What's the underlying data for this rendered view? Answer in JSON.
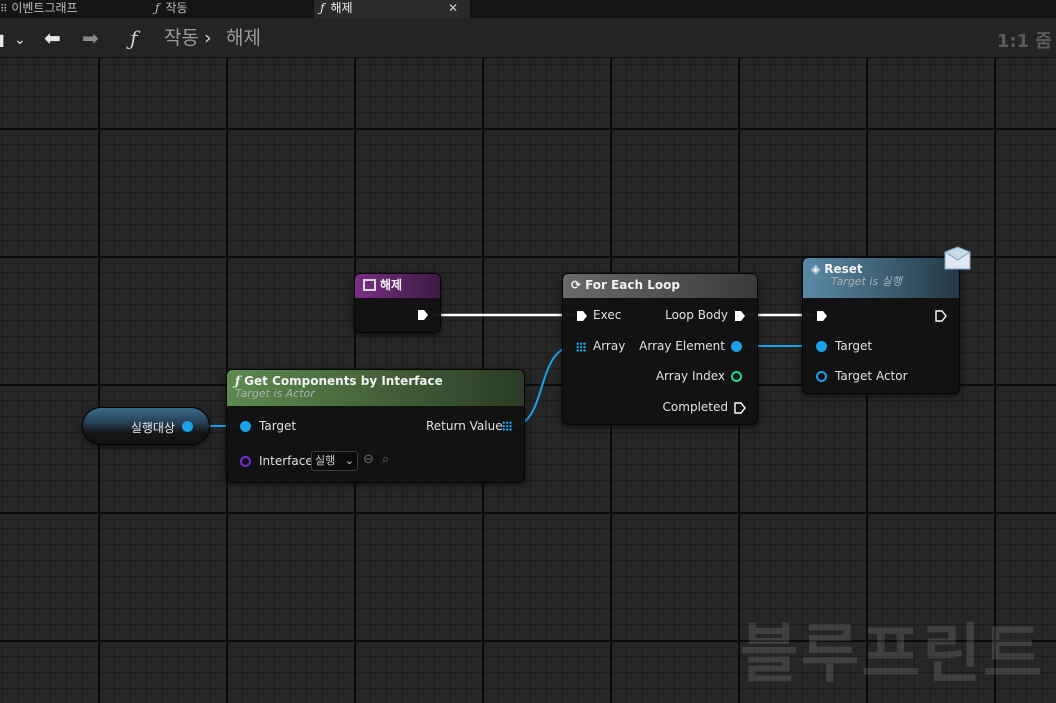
{
  "tabs": [
    {
      "label": "이벤트그래프",
      "icon": "graph-icon"
    },
    {
      "label": "작동",
      "icon": "function-icon"
    },
    {
      "label": "해제",
      "icon": "function-icon",
      "active": true
    }
  ],
  "breadcrumb": {
    "parent": "작동",
    "current": "해제",
    "separator": "›"
  },
  "zoom": "1:1 줌",
  "watermark": "블루프린트",
  "nodes": {
    "entry": {
      "title": "해제"
    },
    "get_components": {
      "title": "Get Components by Interface",
      "subtitle": "Target is Actor",
      "pin_target": "Target",
      "pin_interface": "Interface",
      "interface_value": "실행",
      "pin_return": "Return Value"
    },
    "for_each": {
      "title": "For Each Loop",
      "pin_exec": "Exec",
      "pin_array": "Array",
      "pin_loop_body": "Loop Body",
      "pin_array_element": "Array Element",
      "pin_array_index": "Array Index",
      "pin_completed": "Completed"
    },
    "reset": {
      "title": "Reset",
      "subtitle": "Target is 실행",
      "pin_target": "Target",
      "pin_target_actor": "Target Actor"
    },
    "variable": {
      "label": "실행대상"
    }
  },
  "colors": {
    "exec": "#ffffff",
    "object_pin": "#1ea0e6",
    "interface_pin": "#7a2ad6",
    "int_pin": "#1fd6a4",
    "entry_header": "#6b2a74",
    "function_header": "#4b6b3f",
    "macro_header": "#5a5a5a",
    "message_header": "#3f6f8a"
  }
}
